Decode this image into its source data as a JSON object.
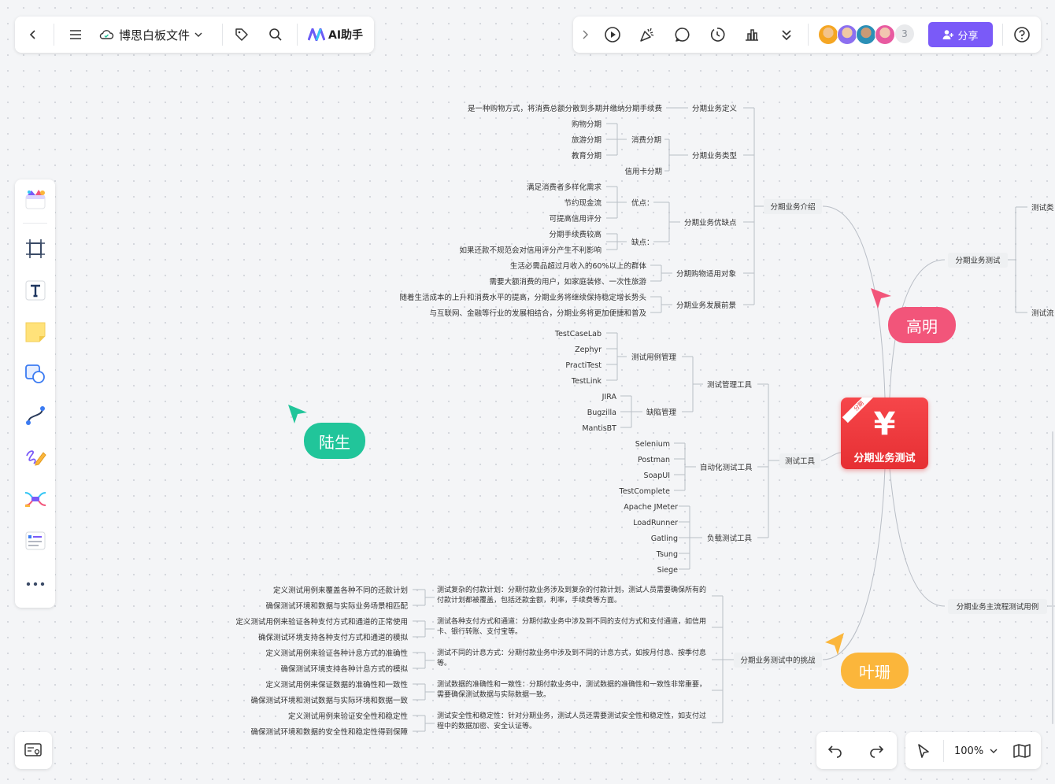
{
  "topbar": {
    "doc_title": "博思白板文件",
    "ai_label": "AI助手",
    "collaborator_extra": "3",
    "share_label": "分享"
  },
  "zoom": {
    "value": "100%"
  },
  "cursors": [
    {
      "name": "陆生",
      "color": "#21c59a"
    },
    {
      "name": "高明",
      "color": "#f2557a"
    },
    {
      "name": "叶珊",
      "color": "#fbb63b"
    }
  ],
  "colors": {
    "accent": "#7a5af8",
    "center": "#f2383c"
  },
  "mindmap": {
    "center": {
      "title": "分期业务测试",
      "badge": "分期"
    },
    "left": [
      {
        "label": "分期业务介绍",
        "children": [
          {
            "label": "分期业务定义",
            "children": [
              {
                "label": "是一种购物方式，将消费总额分散到多期并缴纳分期手续费"
              }
            ]
          },
          {
            "label": "分期业务类型",
            "children": [
              {
                "label": "消费分期",
                "children": [
                  {
                    "label": "购物分期"
                  },
                  {
                    "label": "旅游分期"
                  },
                  {
                    "label": "教育分期"
                  }
                ]
              },
              {
                "label": "信用卡分期"
              }
            ]
          },
          {
            "label": "分期业务优缺点",
            "children": [
              {
                "label": "优点：",
                "children": [
                  {
                    "label": "满足消费者多样化需求"
                  },
                  {
                    "label": "节约现金流"
                  },
                  {
                    "label": "可提高信用评分"
                  }
                ]
              },
              {
                "label": "缺点：",
                "children": [
                  {
                    "label": "分期手续费较高"
                  },
                  {
                    "label": "如果还款不规范会对信用评分产生不利影响"
                  }
                ]
              }
            ]
          },
          {
            "label": "分期购物适用对象",
            "children": [
              {
                "label": "生活必需品超过月收入的60%以上的群体"
              },
              {
                "label": "需要大额消费的用户，如家庭装修、一次性旅游"
              }
            ]
          },
          {
            "label": "分期业务发展前景",
            "children": [
              {
                "label": "随着生活成本的上升和消费水平的提高，分期业务将继续保持稳定增长势头"
              },
              {
                "label": "与互联网、金融等行业的发展相结合，分期业务将更加便捷和普及"
              }
            ]
          }
        ]
      },
      {
        "label": "测试工具",
        "children": [
          {
            "label": "测试管理工具",
            "children": [
              {
                "label": "测试用例管理",
                "children": [
                  {
                    "label": "TestCaseLab"
                  },
                  {
                    "label": "Zephyr"
                  },
                  {
                    "label": "PractiTest"
                  },
                  {
                    "label": "TestLink"
                  }
                ]
              },
              {
                "label": "缺陷管理",
                "children": [
                  {
                    "label": "JIRA"
                  },
                  {
                    "label": "Bugzilla"
                  },
                  {
                    "label": "MantisBT"
                  }
                ]
              }
            ]
          },
          {
            "label": "自动化测试工具",
            "children": [
              {
                "label": "Selenium"
              },
              {
                "label": "Postman"
              },
              {
                "label": "SoapUI"
              },
              {
                "label": "TestComplete"
              }
            ]
          },
          {
            "label": "负载测试工具",
            "children": [
              {
                "label": "Apache JMeter"
              },
              {
                "label": "LoadRunner"
              },
              {
                "label": "Gatling"
              },
              {
                "label": "Tsung"
              },
              {
                "label": "Siege"
              }
            ]
          }
        ]
      },
      {
        "label": "分期业务测试中的挑战",
        "children": [
          {
            "label": "测试复杂的付款计划：分期付款业务涉及到复杂的付款计划，测试人员需要确保所有的付款计划都被覆盖，包括还款金额，利率，手续费等方面。",
            "children": [
              {
                "label": "定义测试用例来覆盖各种不同的还款计划"
              },
              {
                "label": "确保测试环境和数据与实际业务场景相匹配"
              }
            ]
          },
          {
            "label": "测试各种支付方式和通道：分期付款业务中涉及到不同的支付方式和支付通道，如信用卡、银行转账、支付宝等。",
            "children": [
              {
                "label": "定义测试用例来验证各种支付方式和通道的正常使用"
              },
              {
                "label": "确保测试环境支持各种支付方式和通道的模拟"
              }
            ]
          },
          {
            "label": "测试不同的计息方式：分期付款业务中涉及到不同的计息方式，如按月付息、按季付息等。",
            "children": [
              {
                "label": "定义测试用例来验证各种计息方式的准确性"
              },
              {
                "label": "确保测试环境支持各种计息方式的模拟"
              }
            ]
          },
          {
            "label": "测试数据的准确性和一致性：分期付款业务中，测试数据的准确性和一致性非常重要，需要确保测试数据与实际数据一致。",
            "children": [
              {
                "label": "定义测试用例来保证数据的准确性和一致性"
              },
              {
                "label": "确保测试环境和测试数据与实际环境和数据一致"
              }
            ]
          },
          {
            "label": "测试安全性和稳定性：针对分期业务，测试人员还需要测试安全性和稳定性，如支付过程中的数据加密、安全认证等。",
            "children": [
              {
                "label": "定义测试用例来验证安全性和稳定性"
              },
              {
                "label": "确保测试环境和数据的安全性和稳定性得到保障"
              }
            ]
          }
        ]
      }
    ],
    "right": [
      {
        "label": "分期业务测试",
        "children": [
          {
            "label": "测试类"
          },
          {
            "label": "测试流"
          }
        ]
      },
      {
        "label": "分期业务主流程测试用例"
      }
    ]
  }
}
